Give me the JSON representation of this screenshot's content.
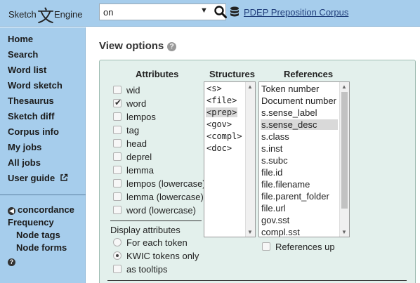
{
  "app": {
    "logo_left": "Sketch",
    "logo_glyph": "文",
    "logo_right": "Engine"
  },
  "search": {
    "value": "on",
    "caret": "▼"
  },
  "corpus": {
    "name": "PDEP Preposition Corpus"
  },
  "sidebar": {
    "items": [
      {
        "label": "Home"
      },
      {
        "label": "Search"
      },
      {
        "label": "Word list"
      },
      {
        "label": "Word sketch"
      },
      {
        "label": "Thesaurus"
      },
      {
        "label": "Sketch diff"
      },
      {
        "label": "Corpus info"
      },
      {
        "label": "My jobs"
      },
      {
        "label": "All jobs"
      },
      {
        "label": "User guide"
      }
    ],
    "concordance": "concordance",
    "frequency": "Frequency",
    "sub_items": [
      "Node tags",
      "Node forms"
    ],
    "help_mark": "?"
  },
  "main": {
    "title": "View options",
    "help_mark": "?"
  },
  "options": {
    "headers": {
      "attributes": "Attributes",
      "structures": "Structures",
      "references": "References"
    },
    "attributes": [
      {
        "label": "wid",
        "checked": false
      },
      {
        "label": "word",
        "checked": true
      },
      {
        "label": "lempos",
        "checked": false
      },
      {
        "label": "tag",
        "checked": false
      },
      {
        "label": "head",
        "checked": false
      },
      {
        "label": "deprel",
        "checked": false
      },
      {
        "label": "lemma",
        "checked": false
      },
      {
        "label": "lempos (lowercase)",
        "checked": false
      },
      {
        "label": "lemma (lowercase)",
        "checked": false
      },
      {
        "label": "word (lowercase)",
        "checked": false
      }
    ],
    "display_attributes": {
      "title": "Display attributes",
      "choices": [
        {
          "label": "For each token",
          "selected": false
        },
        {
          "label": "KWIC tokens only",
          "selected": true
        }
      ],
      "as_tooltips": {
        "label": "as tooltips",
        "checked": false
      }
    },
    "structures": [
      {
        "label": "<s>",
        "selected": false
      },
      {
        "label": "<file>",
        "selected": false
      },
      {
        "label": "<prep>",
        "selected": true
      },
      {
        "label": "<gov>",
        "selected": false
      },
      {
        "label": "<compl>",
        "selected": false
      },
      {
        "label": "<doc>",
        "selected": false
      }
    ],
    "references": [
      {
        "label": "Token number",
        "selected": false
      },
      {
        "label": "Document number",
        "selected": false
      },
      {
        "label": "s.sense_label",
        "selected": false
      },
      {
        "label": "s.sense_desc",
        "selected": true
      },
      {
        "label": "s.class",
        "selected": false
      },
      {
        "label": "s.inst",
        "selected": false
      },
      {
        "label": "s.subc",
        "selected": false
      },
      {
        "label": "file.id",
        "selected": false
      },
      {
        "label": "file.filename",
        "selected": false
      },
      {
        "label": "file.parent_folder",
        "selected": false
      },
      {
        "label": "file.url",
        "selected": false
      },
      {
        "label": "gov.sst",
        "selected": false
      },
      {
        "label": "compl.sst",
        "selected": false
      }
    ],
    "references_up": {
      "label": "References up",
      "checked": false
    }
  },
  "colors": {
    "sidebar_bg": "#a6cdec",
    "panel_bg": "#e3f0ec",
    "link": "#1f3d7a"
  }
}
